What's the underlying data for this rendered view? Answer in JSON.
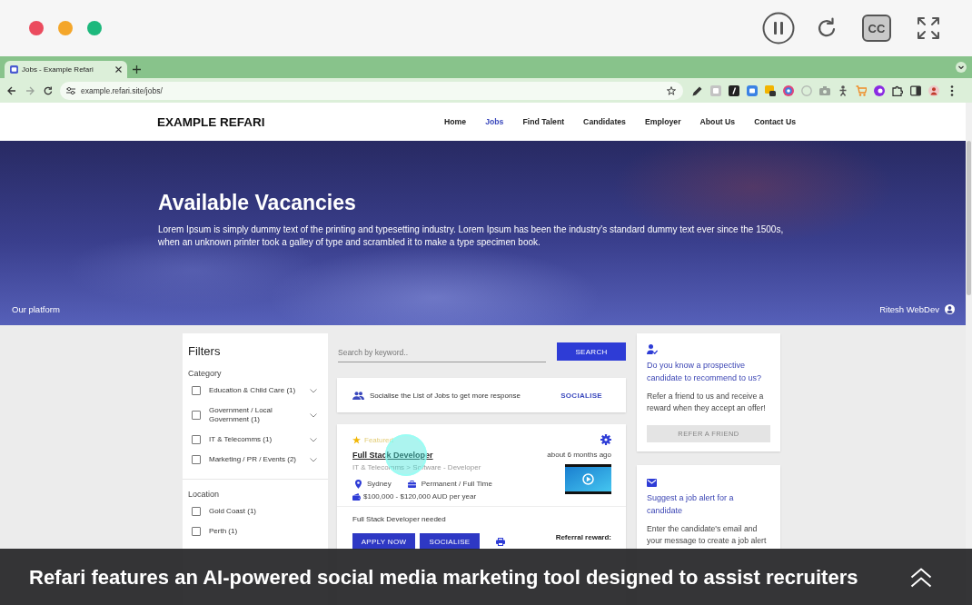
{
  "player": {
    "playing": true,
    "cc_label": "CC"
  },
  "browser": {
    "tabs": [
      {
        "title": "Jobs - Example Refari",
        "selected": true
      }
    ],
    "url": "example.refari.site/jobs/"
  },
  "site": {
    "logo": "EXAMPLE REFARI",
    "nav": [
      {
        "label": "Home",
        "selected": false
      },
      {
        "label": "Jobs",
        "selected": true
      },
      {
        "label": "Find Talent",
        "selected": false
      },
      {
        "label": "Candidates",
        "selected": false
      },
      {
        "label": "Employer",
        "selected": false
      },
      {
        "label": "About Us",
        "selected": false
      },
      {
        "label": "Contact Us",
        "selected": false
      }
    ]
  },
  "hero": {
    "title": "Available Vacancies",
    "description": "Lorem Ipsum is simply dummy text of the printing and typesetting industry. Lorem Ipsum has been the industry's standard dummy text ever since the 1500s, when an unknown printer took a galley of type and scrambled it to make a type specimen book.",
    "footer_left": "Our platform",
    "user": "Ritesh WebDev"
  },
  "filters": {
    "title": "Filters",
    "sections": [
      {
        "title": "Category",
        "options": [
          {
            "label": "Education & Child Care (1)",
            "checked": false,
            "expandable": true
          },
          {
            "label": "Government / Local Government (1)",
            "checked": false,
            "expandable": true
          },
          {
            "label": "IT & Telecomms (1)",
            "checked": false,
            "expandable": true
          },
          {
            "label": "Marketing / PR / Events (2)",
            "checked": false,
            "expandable": true
          }
        ]
      },
      {
        "title": "Location",
        "options": [
          {
            "label": "Gold Coast (1)",
            "checked": false,
            "expandable": false
          },
          {
            "label": "Perth (1)",
            "checked": false,
            "expandable": false
          }
        ]
      }
    ]
  },
  "search": {
    "placeholder": "Search by keyword..",
    "button": "SEARCH"
  },
  "socialise_banner": {
    "text": "Socialise the List of Jobs to get more response",
    "action": "SOCIALISE"
  },
  "jobs": [
    {
      "featured": true,
      "featured_label": "Featured",
      "title": "Full Stack Developer",
      "posted": "about 6 months ago",
      "category": "IT & Telecomms > Software - Developer",
      "location": "Sydney",
      "work_type": "Permanent / Full Time",
      "salary": "$100,000 - $120,000 AUD per year",
      "summary": "Full Stack Developer needed",
      "buttons": [
        "APPLY NOW",
        "SOCIALISE"
      ],
      "reward_label": "Referral reward:"
    }
  ],
  "side_cards": [
    {
      "kind": "refer",
      "title": "Do you know a prospective candidate to recommend to us?",
      "body": "Refer a friend to us and receive a reward when they accept an offer!",
      "button": "REFER A FRIEND",
      "disabled": true
    },
    {
      "kind": "alert",
      "title": "Suggest a job alert for a candidate",
      "body": "Enter the candidate's email and your message to create a job alert"
    }
  ],
  "caption": {
    "text": "Refari features an AI-powered social media marketing tool designed to assist recruiters"
  }
}
